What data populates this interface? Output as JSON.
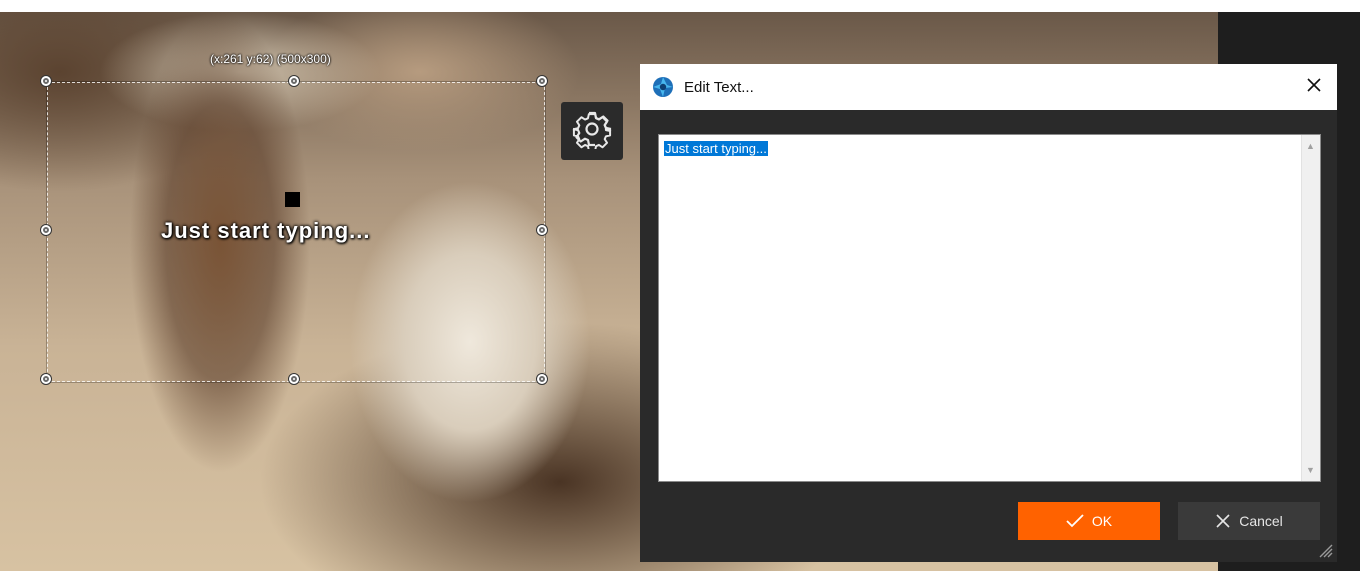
{
  "canvas": {
    "coord_label": "(x:261 y:62) (500x300)",
    "text": "Just start typing..."
  },
  "toolbar": {
    "settings_icon": "gear-icon"
  },
  "dialog": {
    "title": "Edit Text...",
    "app_icon": "aperture-icon",
    "close_icon": "close-icon",
    "text_value": "Just start typing...",
    "ok_label": "OK",
    "cancel_label": "Cancel",
    "ok_icon": "checkmark-icon",
    "cancel_icon": "x-icon",
    "resize_icon": "resize-grip-icon"
  },
  "colors": {
    "accent": "#ff6200",
    "selection": "#0078d7",
    "dialog_bg": "#2a2a2a"
  }
}
